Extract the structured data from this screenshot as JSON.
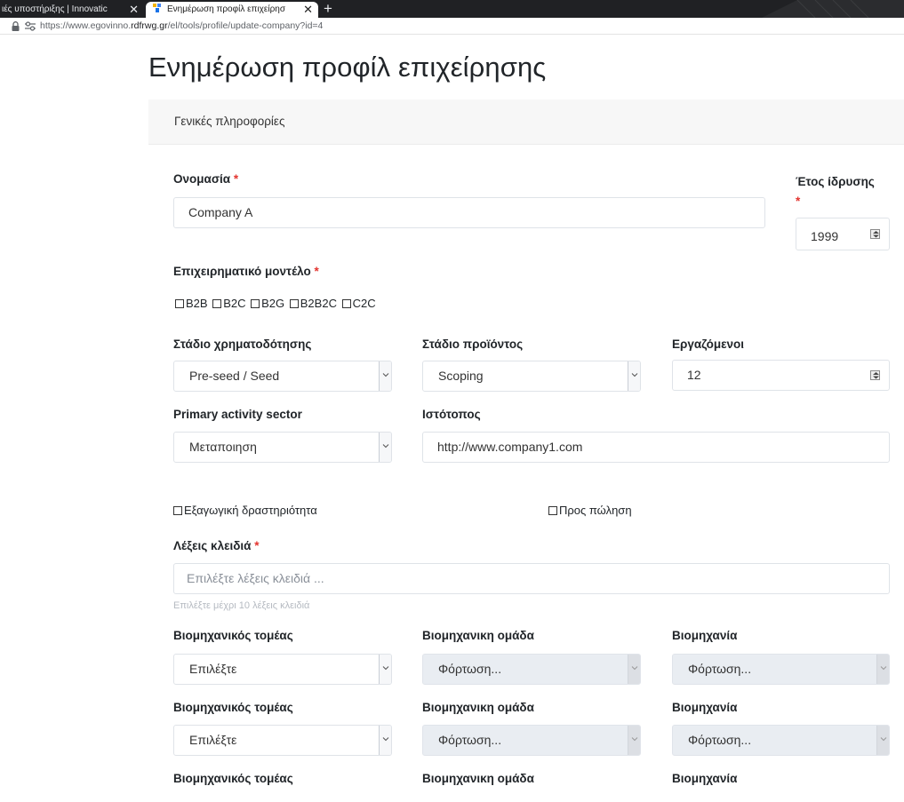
{
  "browser": {
    "tabs": [
      {
        "label": "ιές υποστήριξης | Innovatic",
        "active": false
      },
      {
        "label": "Ενημέρωση προφίλ επιχείρησ",
        "active": true
      }
    ],
    "close_glyph": "✕",
    "new_tab_glyph": "+",
    "url_prefix": "https://www.egovinno.",
    "url_domain": "rdfrwg.gr",
    "url_path": "/el/tools/profile/update-company?id=4"
  },
  "page": {
    "title": "Ενημέρωση προφίλ επιχείρησης",
    "section_header": "Γενικές πληροφορίες"
  },
  "form": {
    "required_mark": "*",
    "name": {
      "label": "Ονομασία",
      "value": "Company A"
    },
    "founded": {
      "label": "Έτος ίδρυσης",
      "value": "1999"
    },
    "business_model": {
      "label": "Επιχειρηματικό μοντέλο",
      "options": [
        "B2B",
        "B2C",
        "B2G",
        "B2B2C",
        "C2C"
      ]
    },
    "funding_stage": {
      "label": "Στάδιο χρηματοδότησης",
      "value": "Pre-seed / Seed"
    },
    "product_stage": {
      "label": "Στάδιο προϊόντος",
      "value": "Scoping"
    },
    "employees": {
      "label": "Εργαζόμενοι",
      "value": "12"
    },
    "primary_sector": {
      "label": "Primary activity sector",
      "value": "Μεταποιηση"
    },
    "website": {
      "label": "Ιστότοπος",
      "value": "http://www.company1.com"
    },
    "export_activity": {
      "label": "Εξαγωγική δραστηριότητα"
    },
    "for_sale": {
      "label": "Προς πώληση"
    },
    "keywords": {
      "label": "Λέξεις κλειδιά",
      "placeholder": "Επιλέξτε λέξεις κλειδιά ...",
      "hint": "Επιλέξτε μέχρι 10 λέξεις κλειδιά"
    },
    "industry_rows": [
      {
        "sector_label": "Βιομηχανικός τομέας",
        "sector_value": "Επιλέξτε",
        "group_label": "Βιομηχανικη ομάδα",
        "group_value": "Φόρτωση...",
        "industry_label": "Βιομηχανία",
        "industry_value": "Φόρτωση..."
      },
      {
        "sector_label": "Βιομηχανικός τομέας",
        "sector_value": "Επιλέξτε",
        "group_label": "Βιομηχανικη ομάδα",
        "group_value": "Φόρτωση...",
        "industry_label": "Βιομηχανία",
        "industry_value": "Φόρτωση..."
      },
      {
        "sector_label": "Βιομηχανικός τομέας",
        "group_label": "Βιομηχανικη ομάδα",
        "industry_label": "Βιομηχανία"
      }
    ]
  },
  "colors": {
    "required": "#e3342f",
    "tabbar": "#202124",
    "disabled_field": "#e9edf2"
  },
  "icons": [
    "favicon-icon",
    "close-icon",
    "plus-icon",
    "lock-icon",
    "tune-icon",
    "chevron-down-icon",
    "spinner-arrows-icon",
    "checkbox-icon"
  ]
}
